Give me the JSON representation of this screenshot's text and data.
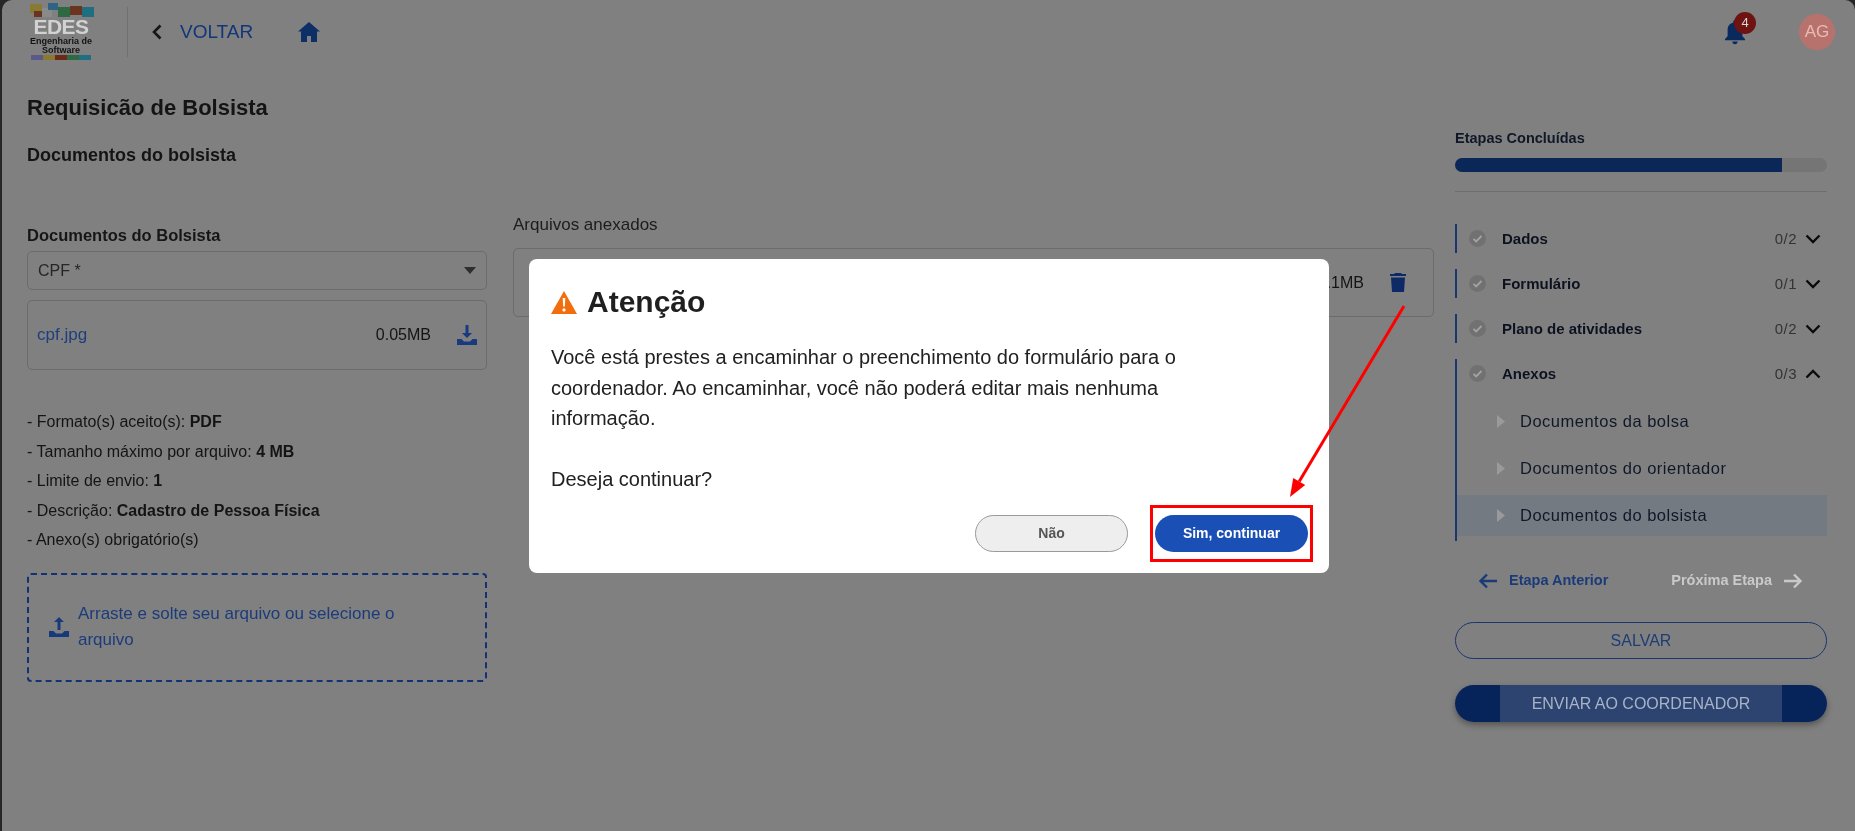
{
  "header": {
    "logo": {
      "text": "EDES",
      "tagline": "Engenharia de Software"
    },
    "back_link": "VOLTAR",
    "notifications": {
      "count": "4"
    },
    "avatar": {
      "initials": "AG"
    }
  },
  "page": {
    "title": "Requisicão de Bolsista",
    "subtitle": "Documentos do bolsista"
  },
  "documents": {
    "label": "Documentos do Bolsista",
    "select": {
      "value": "CPF *"
    },
    "file": {
      "name": "cpf.jpg",
      "size": "0.05MB"
    },
    "requirements": [
      "- Formato(s) aceito(s): **PDF**",
      "- Tamanho máximo por arquivo: **4 MB**",
      "- Limite de envio: **1**",
      "- Descrição: **Cadastro de Pessoa Física**",
      "- Anexo(s) obrigatório(s)"
    ],
    "dropzone": {
      "text": "Arraste e solte seu arquivo ou selecione o arquivo"
    }
  },
  "attachments": {
    "label": "Arquivos anexados",
    "files": [
      {
        "size": ".1MB"
      }
    ]
  },
  "sidebar": {
    "progress": {
      "title": "Etapas Concluídas",
      "level": 0.88
    },
    "steps": [
      {
        "label": "Dados",
        "count": "0/2",
        "completed": false,
        "expanded": false
      },
      {
        "label": "Formulário",
        "count": "0/1",
        "completed": false,
        "expanded": false
      },
      {
        "label": "Plano de atividades",
        "count": "0/2",
        "completed": false,
        "expanded": false
      },
      {
        "label": "Anexos",
        "count": "0/3",
        "completed": false,
        "expanded": true,
        "children": [
          {
            "label": "Documentos da bolsa",
            "selected": false
          },
          {
            "label": "Documentos do orientador",
            "selected": false
          },
          {
            "label": "Documentos do bolsista",
            "selected": true
          }
        ]
      }
    ],
    "navigation": [
      {
        "label": "Etapa Anterior",
        "kind": "previous",
        "disabled": false
      },
      {
        "label": "Próxima Etapa",
        "kind": "next",
        "disabled": true
      }
    ],
    "save_button": "SALVAR",
    "submit_button": "ENVIAR AO COORDENADOR"
  },
  "dialog": {
    "title": "Atenção",
    "message": "Você está prestes a encaminhar o preenchimento do formulário para o coordenador. Ao encaminhar, você não poderá editar mais nenhuma informação.",
    "question": "Deseja continuar?",
    "buttons": [
      {
        "label": "Não",
        "kind": "secondary",
        "annotated": false
      },
      {
        "label": "Sim, continuar",
        "kind": "primary",
        "annotated": true
      }
    ]
  }
}
